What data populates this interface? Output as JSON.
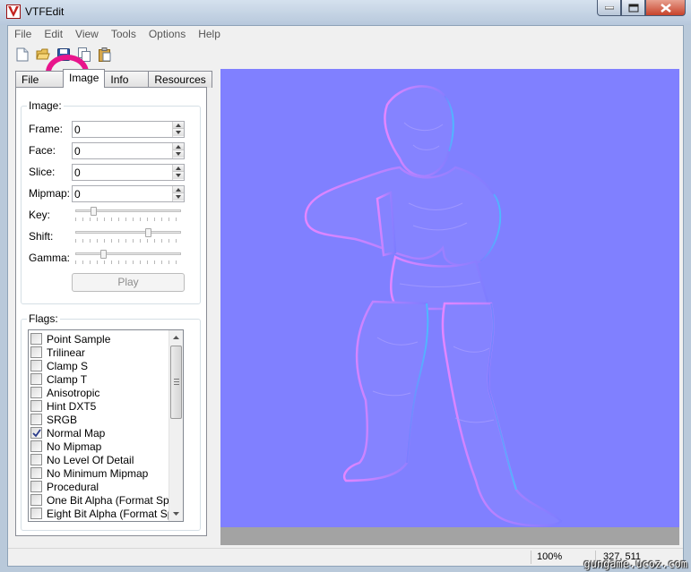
{
  "window": {
    "title": "VTFEdit"
  },
  "menu": [
    "File",
    "Edit",
    "View",
    "Tools",
    "Options",
    "Help"
  ],
  "toolbar": {
    "buttons": [
      "new-file-icon",
      "open-folder-icon",
      "save-icon",
      "copy-icon",
      "paste-icon"
    ],
    "highlight_color": "#e8158c"
  },
  "tabs": [
    "File System",
    "Image",
    "Info",
    "Resources"
  ],
  "active_tab": "Image",
  "image_group": {
    "title": "Image:",
    "frame": {
      "label": "Frame:",
      "value": "0"
    },
    "face": {
      "label": "Face:",
      "value": "0"
    },
    "slice": {
      "label": "Slice:",
      "value": "0"
    },
    "mipmap": {
      "label": "Mipmap:",
      "value": "0"
    },
    "key": {
      "label": "Key:",
      "level": 0.15
    },
    "shift": {
      "label": "Shift:",
      "level": 0.7
    },
    "gamma": {
      "label": "Gamma:",
      "level": 0.25
    },
    "play_label": "Play"
  },
  "flags_group": {
    "title": "Flags:",
    "items": [
      {
        "label": "Point Sample",
        "checked": false
      },
      {
        "label": "Trilinear",
        "checked": false
      },
      {
        "label": "Clamp S",
        "checked": false
      },
      {
        "label": "Clamp T",
        "checked": false
      },
      {
        "label": "Anisotropic",
        "checked": false
      },
      {
        "label": "Hint DXT5",
        "checked": false
      },
      {
        "label": "SRGB",
        "checked": false
      },
      {
        "label": "Normal Map",
        "checked": true
      },
      {
        "label": "No Mipmap",
        "checked": false
      },
      {
        "label": "No Level Of Detail",
        "checked": false
      },
      {
        "label": "No Minimum Mipmap",
        "checked": false
      },
      {
        "label": "Procedural",
        "checked": false
      },
      {
        "label": "One Bit Alpha (Format Spec",
        "checked": false
      },
      {
        "label": "Eight Bit Alpha (Format Spe",
        "checked": false
      }
    ]
  },
  "image_view": {
    "background": "#8080ff"
  },
  "status": {
    "zoom": "100%",
    "cursor": "327, 511"
  },
  "watermark": "gungame.ucoz.com"
}
